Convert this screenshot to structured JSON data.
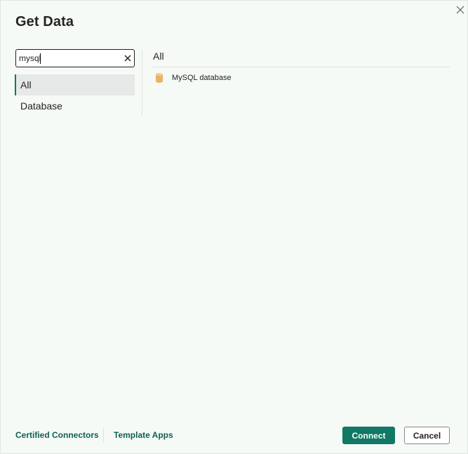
{
  "dialog": {
    "title": "Get Data"
  },
  "search": {
    "value": "mysql",
    "placeholder": ""
  },
  "categories": [
    {
      "label": "All",
      "selected": true
    },
    {
      "label": "Database",
      "selected": false
    }
  ],
  "results": {
    "header": "All",
    "items": [
      {
        "label": "MySQL database",
        "icon": "database-icon"
      }
    ]
  },
  "footer": {
    "certified_connectors": "Certified Connectors",
    "template_apps": "Template Apps",
    "connect_label": "Connect",
    "cancel_label": "Cancel"
  },
  "colors": {
    "background": "#f5faf6",
    "accent": "#117865",
    "link": "#0f5f52",
    "selected_bg": "#e6e9e7",
    "icon_db": "#e8b461"
  }
}
